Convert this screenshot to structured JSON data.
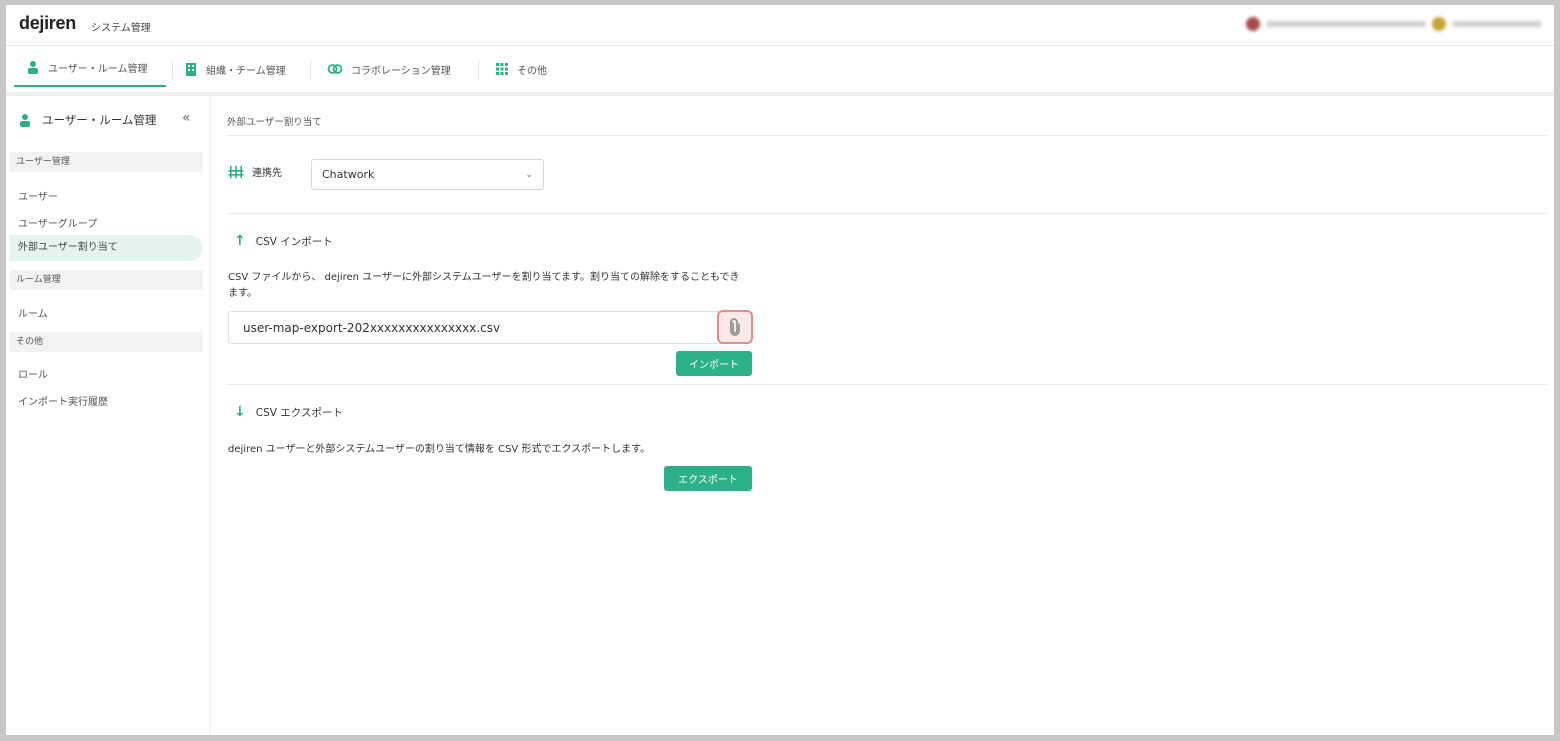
{
  "header": {
    "logo": "dejiren",
    "app_title": "システム管理"
  },
  "tabs": [
    {
      "label": "ユーザー・ルーム管理",
      "icon": "user-icon"
    },
    {
      "label": "組織・チーム管理",
      "icon": "building-icon"
    },
    {
      "label": "コラボレーション管理",
      "icon": "link-icon"
    },
    {
      "label": "その他",
      "icon": "grid-icon"
    }
  ],
  "sidebar": {
    "title": "ユーザー・ルーム管理",
    "collapse": "«",
    "sections": [
      {
        "label": "ユーザー管理",
        "items": [
          "ユーザー",
          "ユーザーグループ",
          "外部ユーザー割り当て"
        ]
      },
      {
        "label": "ルーム管理",
        "items": [
          "ルーム"
        ]
      },
      {
        "label": "その他",
        "items": [
          "ロール",
          "インポート実行履歴"
        ]
      }
    ]
  },
  "main": {
    "breadcrumb": "外部ユーザー割り当て",
    "connection_label": "連携先",
    "connection_value": "Chatwork",
    "import": {
      "title": "CSV インポート",
      "description": "CSV ファイルから、 dejiren ユーザーに外部システムユーザーを割り当てます。割り当ての解除をすることもできます。",
      "file_value": "user-map-export-202xxxxxxxxxxxxxxx.csv",
      "button": "インポート"
    },
    "export": {
      "title": "CSV エクスポート",
      "description": "dejiren ユーザーと外部システムユーザーの割り当て情報を CSV 形式でエクスポートします。",
      "button": "エクスポート"
    }
  },
  "colors": {
    "accent": "#2bb089",
    "highlight": "#e58a8a"
  }
}
